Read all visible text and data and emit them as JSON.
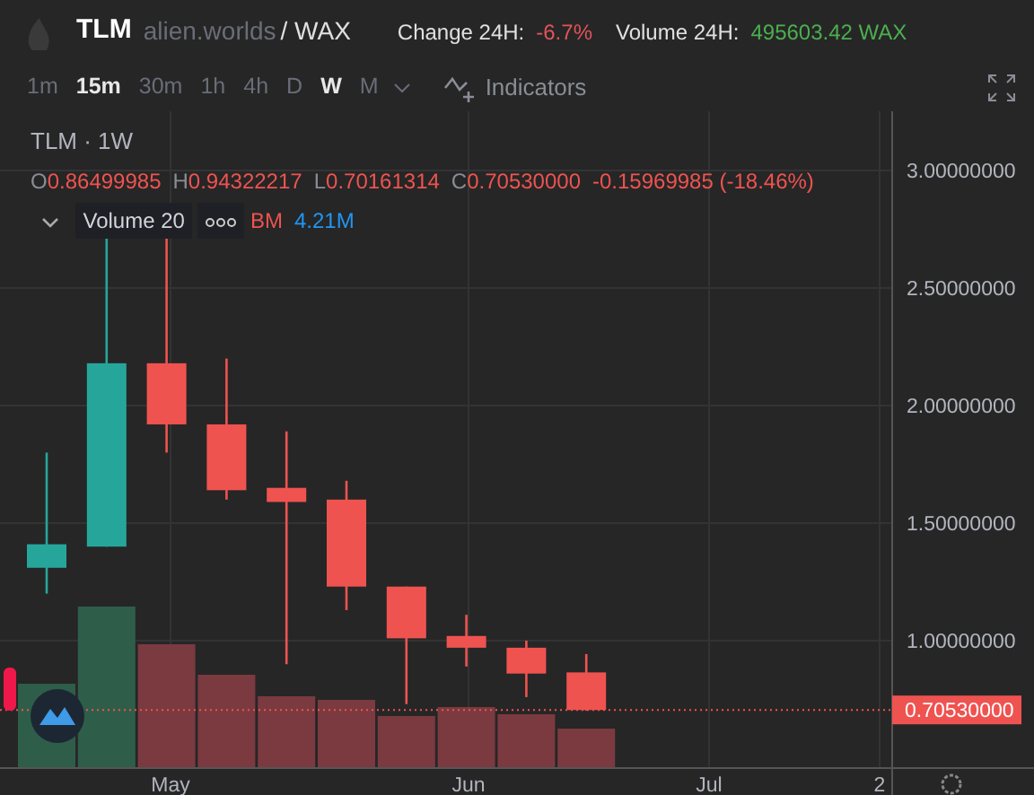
{
  "header": {
    "symbol": "TLM",
    "contract": "alien.worlds",
    "quote": "/ WAX",
    "change_label": "Change 24H:",
    "change_value": "-6.7%",
    "volume_label": "Volume 24H:",
    "volume_value": "495603.42 WAX"
  },
  "intervals": [
    {
      "label": "1m",
      "selected": false
    },
    {
      "label": "15m",
      "selected": true
    },
    {
      "label": "30m",
      "selected": false
    },
    {
      "label": "1h",
      "selected": false
    },
    {
      "label": "4h",
      "selected": false
    },
    {
      "label": "D",
      "selected": false
    },
    {
      "label": "W",
      "selected": true
    },
    {
      "label": "M",
      "selected": false
    }
  ],
  "indicators_label": "Indicators",
  "legend": {
    "title": "TLM · 1W",
    "ohlc": [
      {
        "letter": "O",
        "value": "0.86499985"
      },
      {
        "letter": "H",
        "value": "0.94322217"
      },
      {
        "letter": "L",
        "value": "0.70161314"
      },
      {
        "letter": "C",
        "value": "0.70530000"
      }
    ],
    "change": "-0.15969985 (-18.46%)",
    "study": "Volume 20",
    "study_cut": "BM",
    "study_value": "4.21M"
  },
  "price_axis": [
    "3.00000000",
    "2.50000000",
    "2.00000000",
    "1.50000000",
    "1.00000000"
  ],
  "price_tag": "0.70530000",
  "date_axis": [
    "May",
    "Jun",
    "Jul",
    "2"
  ]
}
